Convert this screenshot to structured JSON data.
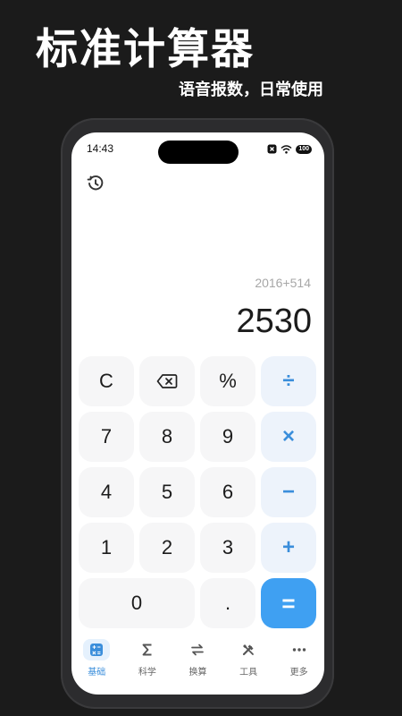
{
  "promo": {
    "title": "标准计算器",
    "subtitle": "语音报数，日常使用"
  },
  "status": {
    "time": "14:43",
    "battery": "100",
    "icons": [
      "close-notice-icon",
      "wifi-icon",
      "battery-icon"
    ]
  },
  "display": {
    "expression": "2016+514",
    "result": "2530"
  },
  "keys": {
    "clear": "C",
    "percent": "%",
    "divide": "÷",
    "seven": "7",
    "eight": "8",
    "nine": "9",
    "multiply": "×",
    "four": "4",
    "five": "5",
    "six": "6",
    "minus": "−",
    "one": "1",
    "two": "2",
    "three": "3",
    "plus": "+",
    "zero": "0",
    "dot": ".",
    "equals": "="
  },
  "tabs": [
    {
      "label": "基础",
      "icon": "basic-calculator-icon",
      "active": true
    },
    {
      "label": "科学",
      "icon": "sigma-icon",
      "active": false
    },
    {
      "label": "换算",
      "icon": "swap-arrows-icon",
      "active": false
    },
    {
      "label": "工具",
      "icon": "tools-icon",
      "active": false
    },
    {
      "label": "更多",
      "icon": "more-dots-icon",
      "active": false
    }
  ],
  "colors": {
    "background": "#1b1b1b",
    "accent": "#3fa0f2",
    "operator_text": "#3a8edb",
    "operator_bg": "#edf3fb",
    "key_bg": "#f6f6f7"
  }
}
